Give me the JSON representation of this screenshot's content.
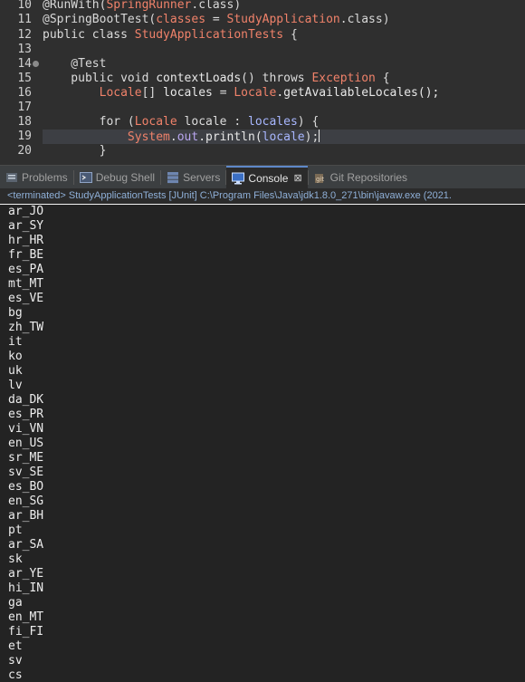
{
  "editor": {
    "lines": [
      {
        "num": "10",
        "segments": [
          {
            "t": "@RunWith(",
            "c": "ann"
          },
          {
            "t": "SpringRunner",
            "c": "ty"
          },
          {
            "t": ".class)",
            "c": "ann"
          }
        ]
      },
      {
        "num": "11",
        "segments": [
          {
            "t": "@SpringBootTest(",
            "c": "ann"
          },
          {
            "t": "classes",
            "c": "ty"
          },
          {
            "t": " = ",
            "c": "ann"
          },
          {
            "t": "StudyApplication",
            "c": "ty"
          },
          {
            "t": ".class)",
            "c": "ann"
          }
        ]
      },
      {
        "num": "12",
        "segments": [
          {
            "t": "public class ",
            "c": "kw"
          },
          {
            "t": "StudyApplicationTests",
            "c": "ty"
          },
          {
            "t": " {",
            "c": "kw"
          }
        ]
      },
      {
        "num": "13",
        "segments": []
      },
      {
        "num": "14",
        "fold": true,
        "segments": [
          {
            "t": "    @Test",
            "c": "ann"
          }
        ]
      },
      {
        "num": "15",
        "segments": [
          {
            "t": "    public void ",
            "c": "kw"
          },
          {
            "t": "contextLoads",
            "c": "meth"
          },
          {
            "t": "() throws ",
            "c": "kw"
          },
          {
            "t": "Exception",
            "c": "ty"
          },
          {
            "t": " {",
            "c": "kw"
          }
        ]
      },
      {
        "num": "16",
        "segments": [
          {
            "t": "        ",
            "c": "kw"
          },
          {
            "t": "Locale",
            "c": "ty"
          },
          {
            "t": "[] ",
            "c": "kw"
          },
          {
            "t": "locales",
            "c": "meth"
          },
          {
            "t": " = ",
            "c": "kw"
          },
          {
            "t": "Locale",
            "c": "ty"
          },
          {
            "t": ".getAvailableLocales();",
            "c": "meth"
          }
        ]
      },
      {
        "num": "17",
        "segments": []
      },
      {
        "num": "18",
        "segments": [
          {
            "t": "        for (",
            "c": "kw"
          },
          {
            "t": "Locale",
            "c": "ty"
          },
          {
            "t": " locale : ",
            "c": "kw"
          },
          {
            "t": "locales",
            "c": "var"
          },
          {
            "t": ") {",
            "c": "kw"
          }
        ]
      },
      {
        "num": "19",
        "current": true,
        "caret": true,
        "segments": [
          {
            "t": "            ",
            "c": "kw"
          },
          {
            "t": "System",
            "c": "sysclass"
          },
          {
            "t": ".",
            "c": "kw"
          },
          {
            "t": "out",
            "c": "fld"
          },
          {
            "t": ".println(",
            "c": "meth"
          },
          {
            "t": "locale",
            "c": "var"
          },
          {
            "t": ");",
            "c": "kw"
          }
        ]
      },
      {
        "num": "20",
        "segments": [
          {
            "t": "        }",
            "c": "kw"
          }
        ]
      }
    ]
  },
  "tabs": [
    {
      "label": "Problems",
      "icon": "problems-icon",
      "active": false
    },
    {
      "label": "Debug Shell",
      "icon": "debug-shell-icon",
      "active": false
    },
    {
      "label": "Servers",
      "icon": "servers-icon",
      "active": false
    },
    {
      "label": "Console",
      "icon": "console-icon",
      "active": true,
      "close": "⊠"
    },
    {
      "label": "Git Repositories",
      "icon": "git-repositories-icon",
      "active": false
    }
  ],
  "console": {
    "header": "<terminated> StudyApplicationTests [JUnit] C:\\Program Files\\Java\\jdk1.8.0_271\\bin\\javaw.exe  (2021.",
    "lines": [
      "ar_JO",
      "ar_SY",
      "hr_HR",
      "fr_BE",
      "es_PA",
      "mt_MT",
      "es_VE",
      "bg",
      "zh_TW",
      "it",
      "ko",
      "uk",
      "lv",
      "da_DK",
      "es_PR",
      "vi_VN",
      "en_US",
      "sr_ME",
      "sv_SE",
      "es_BO",
      "en_SG",
      "ar_BH",
      "pt",
      "ar_SA",
      "sk",
      "ar_YE",
      "hi_IN",
      "ga",
      "en_MT",
      "fi_FI",
      "et",
      "sv",
      "cs"
    ]
  },
  "colors": {
    "editor_bg": "#2f2f2f",
    "current_line": "#3d3f44",
    "type_color": "#f0826a",
    "tab_active_accent": "#5e88c9",
    "console_bg": "#232323"
  }
}
